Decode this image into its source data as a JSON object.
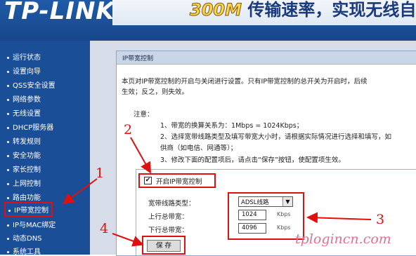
{
  "header": {
    "logo": "TP-LINK",
    "banner_number": "300M",
    "banner_text": "传输速率，实现无线自由"
  },
  "sidebar": {
    "items": [
      {
        "label": "运行状态"
      },
      {
        "label": "设置向导"
      },
      {
        "label": "QSS安全设置"
      },
      {
        "label": "网络参数"
      },
      {
        "label": "无线设置"
      },
      {
        "label": "DHCP服务器"
      },
      {
        "label": "转发规则"
      },
      {
        "label": "安全功能"
      },
      {
        "label": "家长控制"
      },
      {
        "label": "上网控制"
      },
      {
        "label": "路由功能"
      },
      {
        "label": "IP带宽控制"
      },
      {
        "label": "IP与MAC绑定"
      },
      {
        "label": "动态DNS"
      },
      {
        "label": "系统工具"
      }
    ],
    "selected_index": 11
  },
  "panel": {
    "title": "IP带宽控制",
    "intro_line1": "本页对IP带宽控制的开启与关闭进行设置。只有IP带宽控制的总开关为开启时，后续",
    "intro_line2": "生效；反之，则失效。",
    "note_label": "注意：",
    "note1": "1、带宽的换算关系为：1Mbps = 1024Kbps；",
    "note2a": "2、选择宽带线路类型及填写带宽大小时，请根据实际情况进行选择和填写，如",
    "note2b": "供商（如电信、网通等）；",
    "note3": "3、修改下面的配置项后，请点击“保存”按钮，使配置项生效。"
  },
  "form": {
    "enable_label": "开启IP带宽控制",
    "enable_checked": "✔",
    "line_type_label": "宽带线路类型：",
    "line_type_value": "ADSL线路",
    "upload_label": "上行总带宽：",
    "upload_value": "1024",
    "download_label": "下行总带宽：",
    "download_value": "4096",
    "unit": "Kbps",
    "save_label": "保 存"
  },
  "callouts": {
    "c1": "1",
    "c2": "2",
    "c3": "3",
    "c4": "4"
  },
  "watermark": "tplogincn.com",
  "colors": {
    "sidebar_bg": "#1a4f97",
    "annotation_red": "#e01010"
  }
}
